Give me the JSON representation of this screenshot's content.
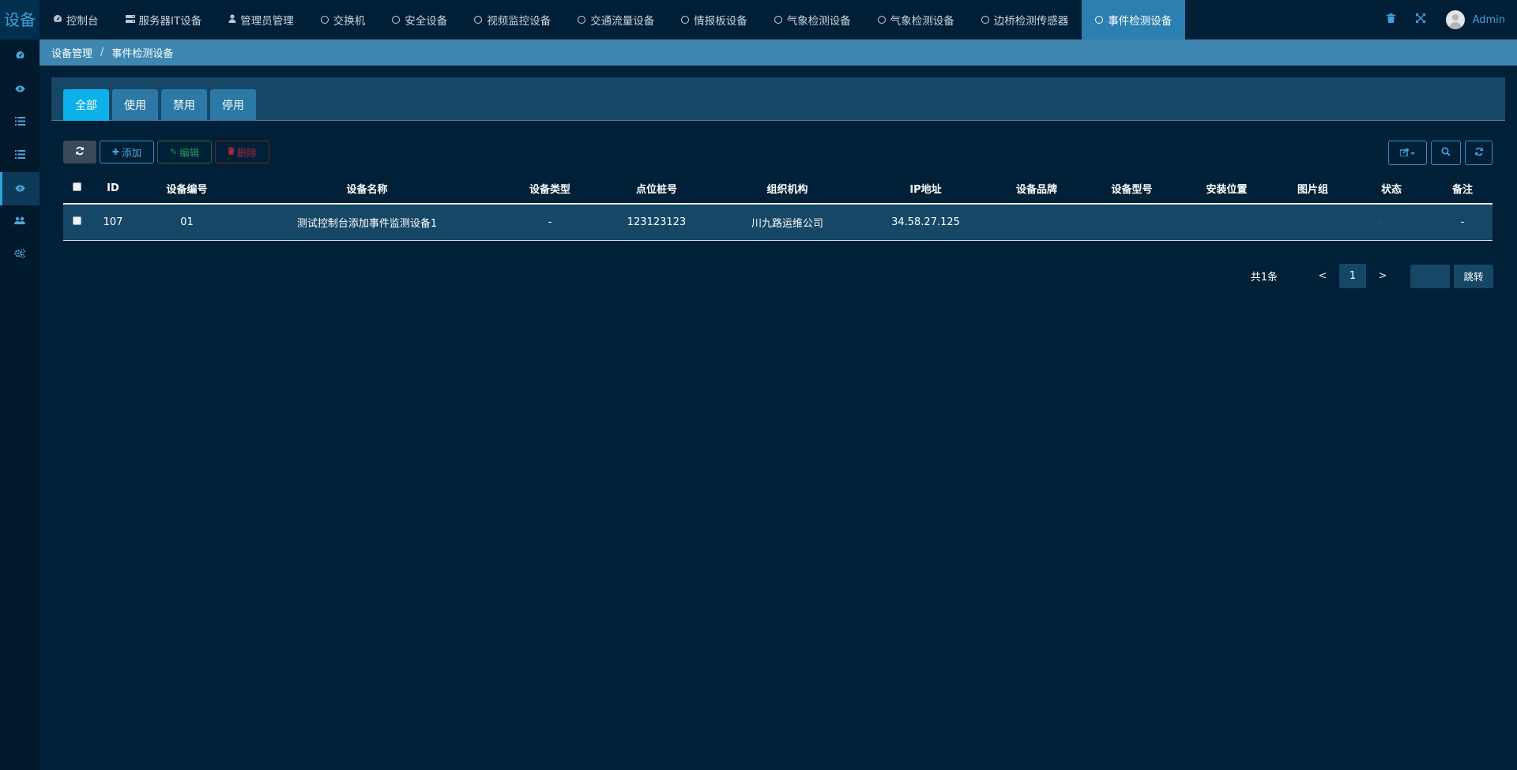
{
  "app": {
    "logo": "设备"
  },
  "topnav": [
    {
      "label": "控制台",
      "icon": "dashboard-icon"
    },
    {
      "label": "服务器IT设备",
      "icon": "server-icon"
    },
    {
      "label": "管理员管理",
      "icon": "user-icon"
    },
    {
      "label": "交换机",
      "icon": "circle-icon"
    },
    {
      "label": "安全设备",
      "icon": "circle-icon"
    },
    {
      "label": "视频监控设备",
      "icon": "circle-icon"
    },
    {
      "label": "交通流量设备",
      "icon": "circle-icon"
    },
    {
      "label": "情报板设备",
      "icon": "circle-icon"
    },
    {
      "label": "气象检测设备",
      "icon": "circle-icon"
    },
    {
      "label": "气象检测设备",
      "icon": "circle-icon"
    },
    {
      "label": "边桥检测传感器",
      "icon": "circle-icon"
    },
    {
      "label": "事件检测设备",
      "icon": "circle-icon",
      "active": true
    }
  ],
  "user": {
    "name": "Admin"
  },
  "breadcrumb": {
    "parent": "设备管理",
    "separator": "/",
    "current": "事件检测设备"
  },
  "tabs": [
    "全部",
    "使用",
    "禁用",
    "停用"
  ],
  "toolbar": {
    "add": "添加",
    "edit": "编辑",
    "delete": "删除"
  },
  "table": {
    "columns": [
      "ID",
      "设备编号",
      "设备名称",
      "设备类型",
      "点位桩号",
      "组织机构",
      "IP地址",
      "设备品牌",
      "设备型号",
      "安装位置",
      "图片组",
      "状态",
      "备注"
    ],
    "rows": [
      {
        "id": "107",
        "code": "01",
        "name": "测试控制台添加事件监测设备1",
        "type": "-",
        "point": "123123123",
        "org": "川九路运维公司",
        "ip": "34.58.27.125",
        "brand": "",
        "model": "",
        "location": "",
        "pics": "",
        "status": "正常",
        "remark": "-"
      }
    ]
  },
  "pager": {
    "total": "共1条",
    "prev": "<",
    "page": "1",
    "next": ">",
    "jump": "跳转"
  },
  "colors": {
    "accent": "#0cb0ea",
    "topbar": "#001f36",
    "content_bg": "#002038",
    "breadcrumb_bg": "#3d87b0",
    "row_bg": "#164766"
  }
}
